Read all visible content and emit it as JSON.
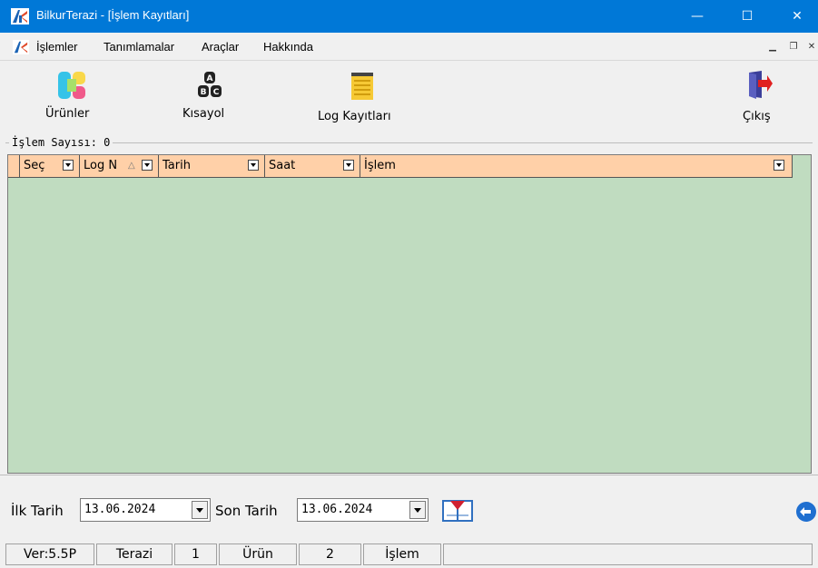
{
  "window": {
    "title": "BilkurTerazi  - [İşlem Kayıtları]",
    "minimize_glyph": "—",
    "maximize_glyph": "☐",
    "close_glyph": "✕"
  },
  "menu": {
    "items": [
      "İşlemler",
      "Tanımlamalar",
      "Araçlar",
      "Hakkında"
    ]
  },
  "toolbar": {
    "items": [
      {
        "label": "Ürünler",
        "icon": "products-icon"
      },
      {
        "label": "Kısayol",
        "icon": "abc-shortcut-icon"
      },
      {
        "label": "Log Kayıtları",
        "icon": "log-records-icon"
      },
      {
        "label": "Çıkış",
        "icon": "exit-door-icon"
      }
    ]
  },
  "group": {
    "label": "İşlem Sayısı: 0"
  },
  "grid": {
    "columns": [
      "Seç",
      "Log N",
      "Tarih",
      "Saat",
      "İşlem"
    ],
    "header_color": "#ffd0a8",
    "background_color": "#c0dcc0",
    "rows": []
  },
  "filters": {
    "start_label": "İlk Tarih",
    "start_value": "13.06.2024",
    "end_label": "Son Tarih",
    "end_value": "13.06.2024"
  },
  "status": {
    "cells": [
      "Ver:5.5P",
      "Terazi",
      "1",
      "Ürün",
      "2",
      "İşlem"
    ]
  },
  "colors": {
    "titlebar": "#0078d7"
  }
}
